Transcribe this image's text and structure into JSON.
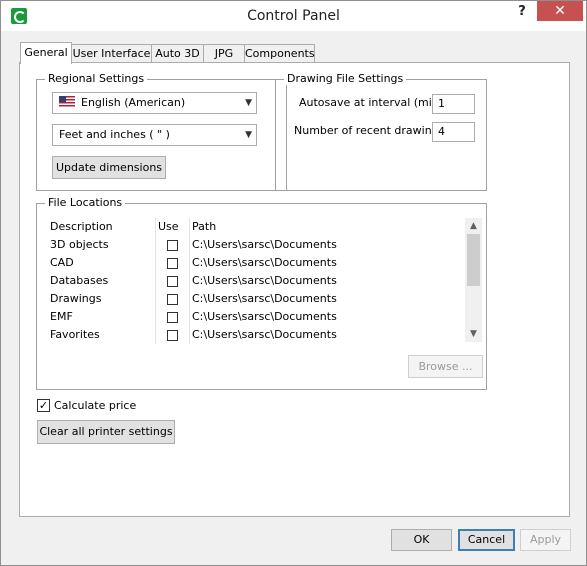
{
  "window": {
    "title": "Control Panel",
    "help_label": "?",
    "close_label": "✕"
  },
  "tabs": [
    {
      "label": "General",
      "active": true
    },
    {
      "label": "User Interface"
    },
    {
      "label": "Auto 3D"
    },
    {
      "label": "JPG"
    },
    {
      "label": "Components"
    }
  ],
  "regional": {
    "group_label": "Regional Settings",
    "language_value": "English (American)",
    "units_value": "Feet and inches ( \" )",
    "update_button": "Update dimensions"
  },
  "drawing": {
    "group_label": "Drawing File Settings",
    "autosave_label": "Autosave at interval (min)",
    "autosave_value": "1",
    "recent_label": "Number of recent drawings",
    "recent_value": "4"
  },
  "files": {
    "group_label": "File Locations",
    "columns": [
      "Description",
      "Use",
      "Path"
    ],
    "rows": [
      {
        "description": "3D objects",
        "use": false,
        "path": "C:\\Users\\sarsc\\Documents"
      },
      {
        "description": "CAD",
        "use": false,
        "path": "C:\\Users\\sarsc\\Documents"
      },
      {
        "description": "Databases",
        "use": false,
        "path": "C:\\Users\\sarsc\\Documents"
      },
      {
        "description": "Drawings",
        "use": false,
        "path": "C:\\Users\\sarsc\\Documents"
      },
      {
        "description": "EMF",
        "use": false,
        "path": "C:\\Users\\sarsc\\Documents"
      },
      {
        "description": "Favorites",
        "use": false,
        "path": "C:\\Users\\sarsc\\Documents"
      }
    ],
    "browse_button": "Browse ..."
  },
  "calculate_price": {
    "label": "Calculate price",
    "checked": true
  },
  "clear_printer_button": "Clear all printer settings",
  "footer": {
    "ok": "OK",
    "cancel": "Cancel",
    "apply": "Apply"
  },
  "colors": {
    "close_button": "#c75050",
    "focus_border": "#3c7fb1",
    "app_icon": "#1a9a3a"
  }
}
